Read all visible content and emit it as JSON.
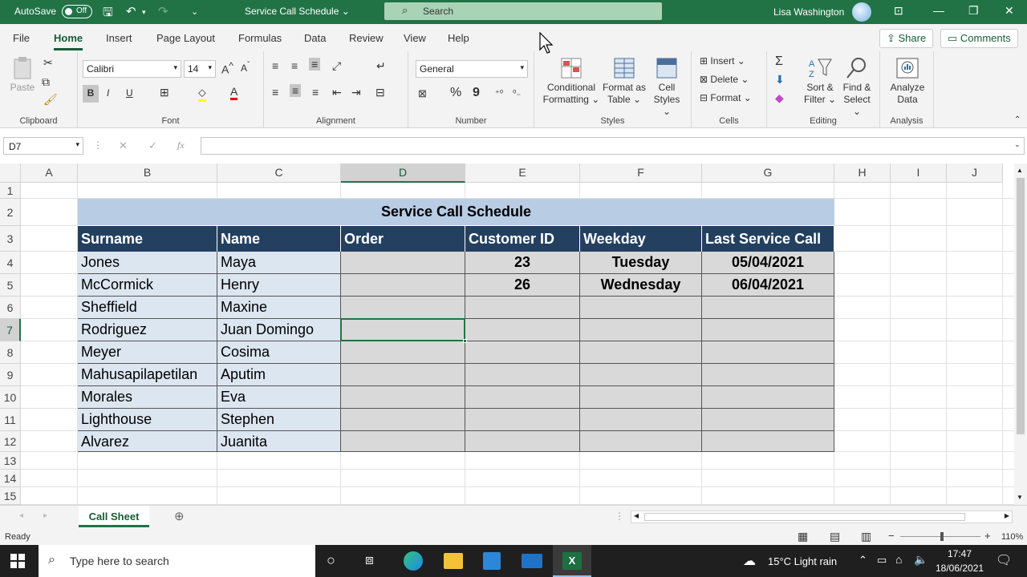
{
  "titlebar": {
    "autosave_label": "AutoSave",
    "autosave_state": "Off",
    "doc_title": "Service Call Schedule",
    "search_label": "Search",
    "user_name": "Lisa Washington"
  },
  "tabs": [
    "File",
    "Home",
    "Insert",
    "Page Layout",
    "Formulas",
    "Data",
    "Review",
    "View",
    "Help"
  ],
  "active_tab": "Home",
  "share_label": "Share",
  "comments_label": "Comments",
  "ribbon": {
    "clipboard": {
      "paste": "Paste",
      "label": "Clipboard"
    },
    "font": {
      "name": "Calibri",
      "size": "14",
      "bold": "B",
      "italic": "I",
      "underline": "U",
      "label": "Font"
    },
    "alignment": {
      "label": "Alignment"
    },
    "number": {
      "format": "General",
      "percent": "%",
      "comma": "9",
      "label": "Number"
    },
    "styles": {
      "cond_line1": "Conditional",
      "cond_line2": "Formatting ⌄",
      "fmt_line1": "Format as",
      "fmt_line2": "Table ⌄",
      "cell_line1": "Cell",
      "cell_line2": "Styles ⌄",
      "label": "Styles"
    },
    "cells": {
      "insert": "Insert",
      "delete": "Delete",
      "format": "Format",
      "label": "Cells"
    },
    "editing": {
      "sort_line1": "Sort &",
      "sort_line2": "Filter ⌄",
      "find_line1": "Find &",
      "find_line2": "Select ⌄",
      "label": "Editing"
    },
    "analysis": {
      "line1": "Analyze",
      "line2": "Data",
      "label": "Analysis"
    }
  },
  "formula_bar": {
    "name_box": "D7",
    "content": ""
  },
  "columns": [
    "A",
    "B",
    "C",
    "D",
    "E",
    "F",
    "G",
    "H",
    "I",
    "J"
  ],
  "rows": [
    "1",
    "2",
    "3",
    "4",
    "5",
    "6",
    "7",
    "8",
    "9",
    "10",
    "11",
    "12",
    "13",
    "14",
    "15"
  ],
  "table": {
    "title": "Service Call Schedule",
    "headers": [
      "Surname",
      "Name",
      "Order",
      "Customer ID",
      "Weekday",
      "Last Service Call"
    ],
    "rows": [
      [
        "Jones",
        "Maya",
        "",
        "23",
        "Tuesday",
        "05/04/2021"
      ],
      [
        "McCormick",
        "Henry",
        "",
        "26",
        "Wednesday",
        "06/04/2021"
      ],
      [
        "Sheffield",
        "Maxine",
        "",
        "",
        "",
        ""
      ],
      [
        "Rodriguez",
        "Juan Domingo",
        "",
        "",
        "",
        ""
      ],
      [
        "Meyer",
        "Cosima",
        "",
        "",
        "",
        ""
      ],
      [
        "Mahusapilapetilan",
        "Aputim",
        "",
        "",
        "",
        ""
      ],
      [
        "Morales",
        "Eva",
        "",
        "",
        "",
        ""
      ],
      [
        "Lighthouse",
        "Stephen",
        "",
        "",
        "",
        ""
      ],
      [
        "Alvarez",
        "Juanita",
        "",
        "",
        "",
        ""
      ]
    ]
  },
  "sheet_tab": "Call Sheet",
  "status": {
    "ready": "Ready",
    "zoom": "110%"
  },
  "taskbar": {
    "search_placeholder": "Type here to search",
    "weather": "15°C  Light rain",
    "time": "17:47",
    "date": "18/06/2021"
  },
  "colors": {
    "excel_green": "#217346",
    "header_fill": "#244061",
    "title_fill": "#b8cce4",
    "name_fill": "#dce6f1",
    "data_fill": "#d9d9d9"
  }
}
